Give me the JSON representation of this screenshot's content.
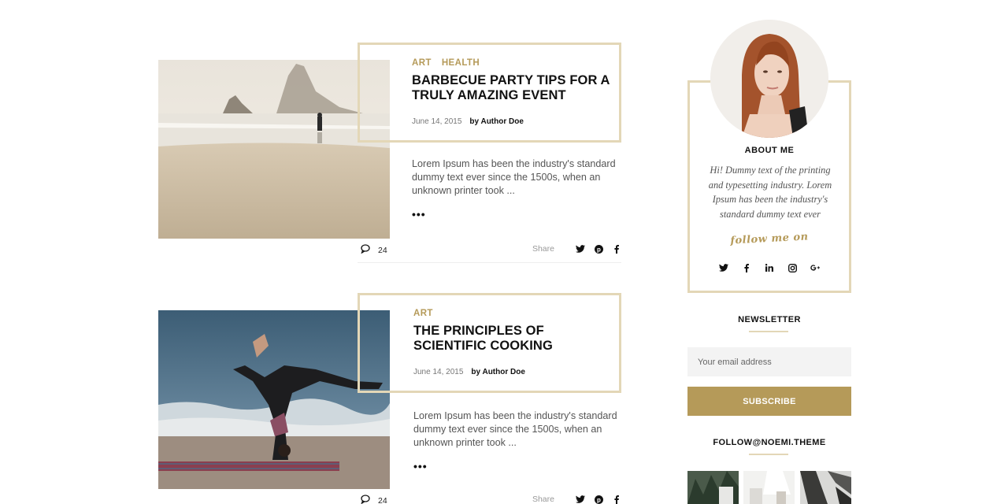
{
  "posts": [
    {
      "categories": [
        "ART",
        "HEALTH"
      ],
      "title": "BARBECUE PARTY TIPS FOR A TRULY AMAZING EVENT",
      "date": "June 14, 2015",
      "author": "by Author Doe",
      "excerpt": "Lorem Ipsum has been the industry's standard dummy text ever since the 1500s, when an unknown printer took ...",
      "more": "•••",
      "comments": "24",
      "share_label": "Share"
    },
    {
      "categories": [
        "ART"
      ],
      "title": "THE PRINCIPLES OF SCIENTIFIC COOKING",
      "date": "June 14, 2015",
      "author": "by Author Doe",
      "excerpt": "Lorem Ipsum has been the industry's standard dummy text ever since the 1500s, when an unknown printer took ...",
      "more": "•••",
      "comments": "24",
      "share_label": "Share"
    }
  ],
  "sidebar": {
    "about": {
      "title": "ABOUT ME",
      "text": "Hi! Dummy text of the printing and typesetting industry. Lorem Ipsum has been the industry's standard dummy text ever",
      "follow_script": "follow me on",
      "social_icons": [
        "twitter-icon",
        "facebook-icon",
        "linkedin-icon",
        "instagram-icon",
        "google-plus-icon"
      ]
    },
    "newsletter": {
      "title": "NEWSLETTER",
      "placeholder": "Your email address",
      "button": "SUBSCRIBE"
    },
    "instagram": {
      "title": "FOLLOW@NOEMI.THEME"
    }
  },
  "colors": {
    "accent": "#b59a59",
    "frame": "#e3d7b7"
  }
}
